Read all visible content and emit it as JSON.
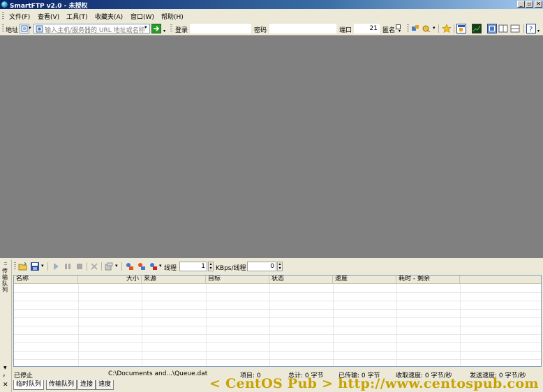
{
  "window": {
    "title": "SmartFTP v2.0 - 未授权",
    "min": "_",
    "restore": "▫",
    "close": "✕"
  },
  "menu": {
    "items": [
      {
        "label": "文件(F)"
      },
      {
        "label": "查看(V)"
      },
      {
        "label": "工具(T)"
      },
      {
        "label": "收藏夹(A)"
      },
      {
        "label": "窗口(W)"
      },
      {
        "label": "帮助(H)"
      }
    ]
  },
  "address_bar": {
    "address_label": "地址",
    "address_placeholder": "输入主机/服务器的 URL 地址或名称",
    "login_label": "登录",
    "password_label": "密码",
    "port_label": "端口",
    "port_value": "21",
    "anonymous_label": "匿名"
  },
  "queue_toolbar": {
    "threads_label": "线程",
    "threads_value": "1",
    "kbps_label": "KBps/线程",
    "kbps_value": "0"
  },
  "queue_table": {
    "columns": [
      "名称",
      "大小",
      "来源",
      "目标",
      "状态",
      "速度",
      "耗时 - 剩余"
    ]
  },
  "side_panel": {
    "label": "传输队列"
  },
  "status": {
    "state": "已停止",
    "path": "C:\\Documents and...\\Queue.dat",
    "items": "项目: 0",
    "total": "总计: 0 字节",
    "transferred": "已传输: 0 字节",
    "recv_speed": "收取速度: 0 字节/秒",
    "send_speed": "发送速度: 0 字节/秒"
  },
  "tabs": [
    {
      "label": "临时队列"
    },
    {
      "label": "传输队列"
    },
    {
      "label": "连接"
    },
    {
      "label": "速度"
    }
  ],
  "watermark": "< CentOS Pub > http://www.centospub.com",
  "colors": {
    "workspace": "#808080",
    "titlebar_start": "#0a246a",
    "chrome": "#ece9d8"
  }
}
